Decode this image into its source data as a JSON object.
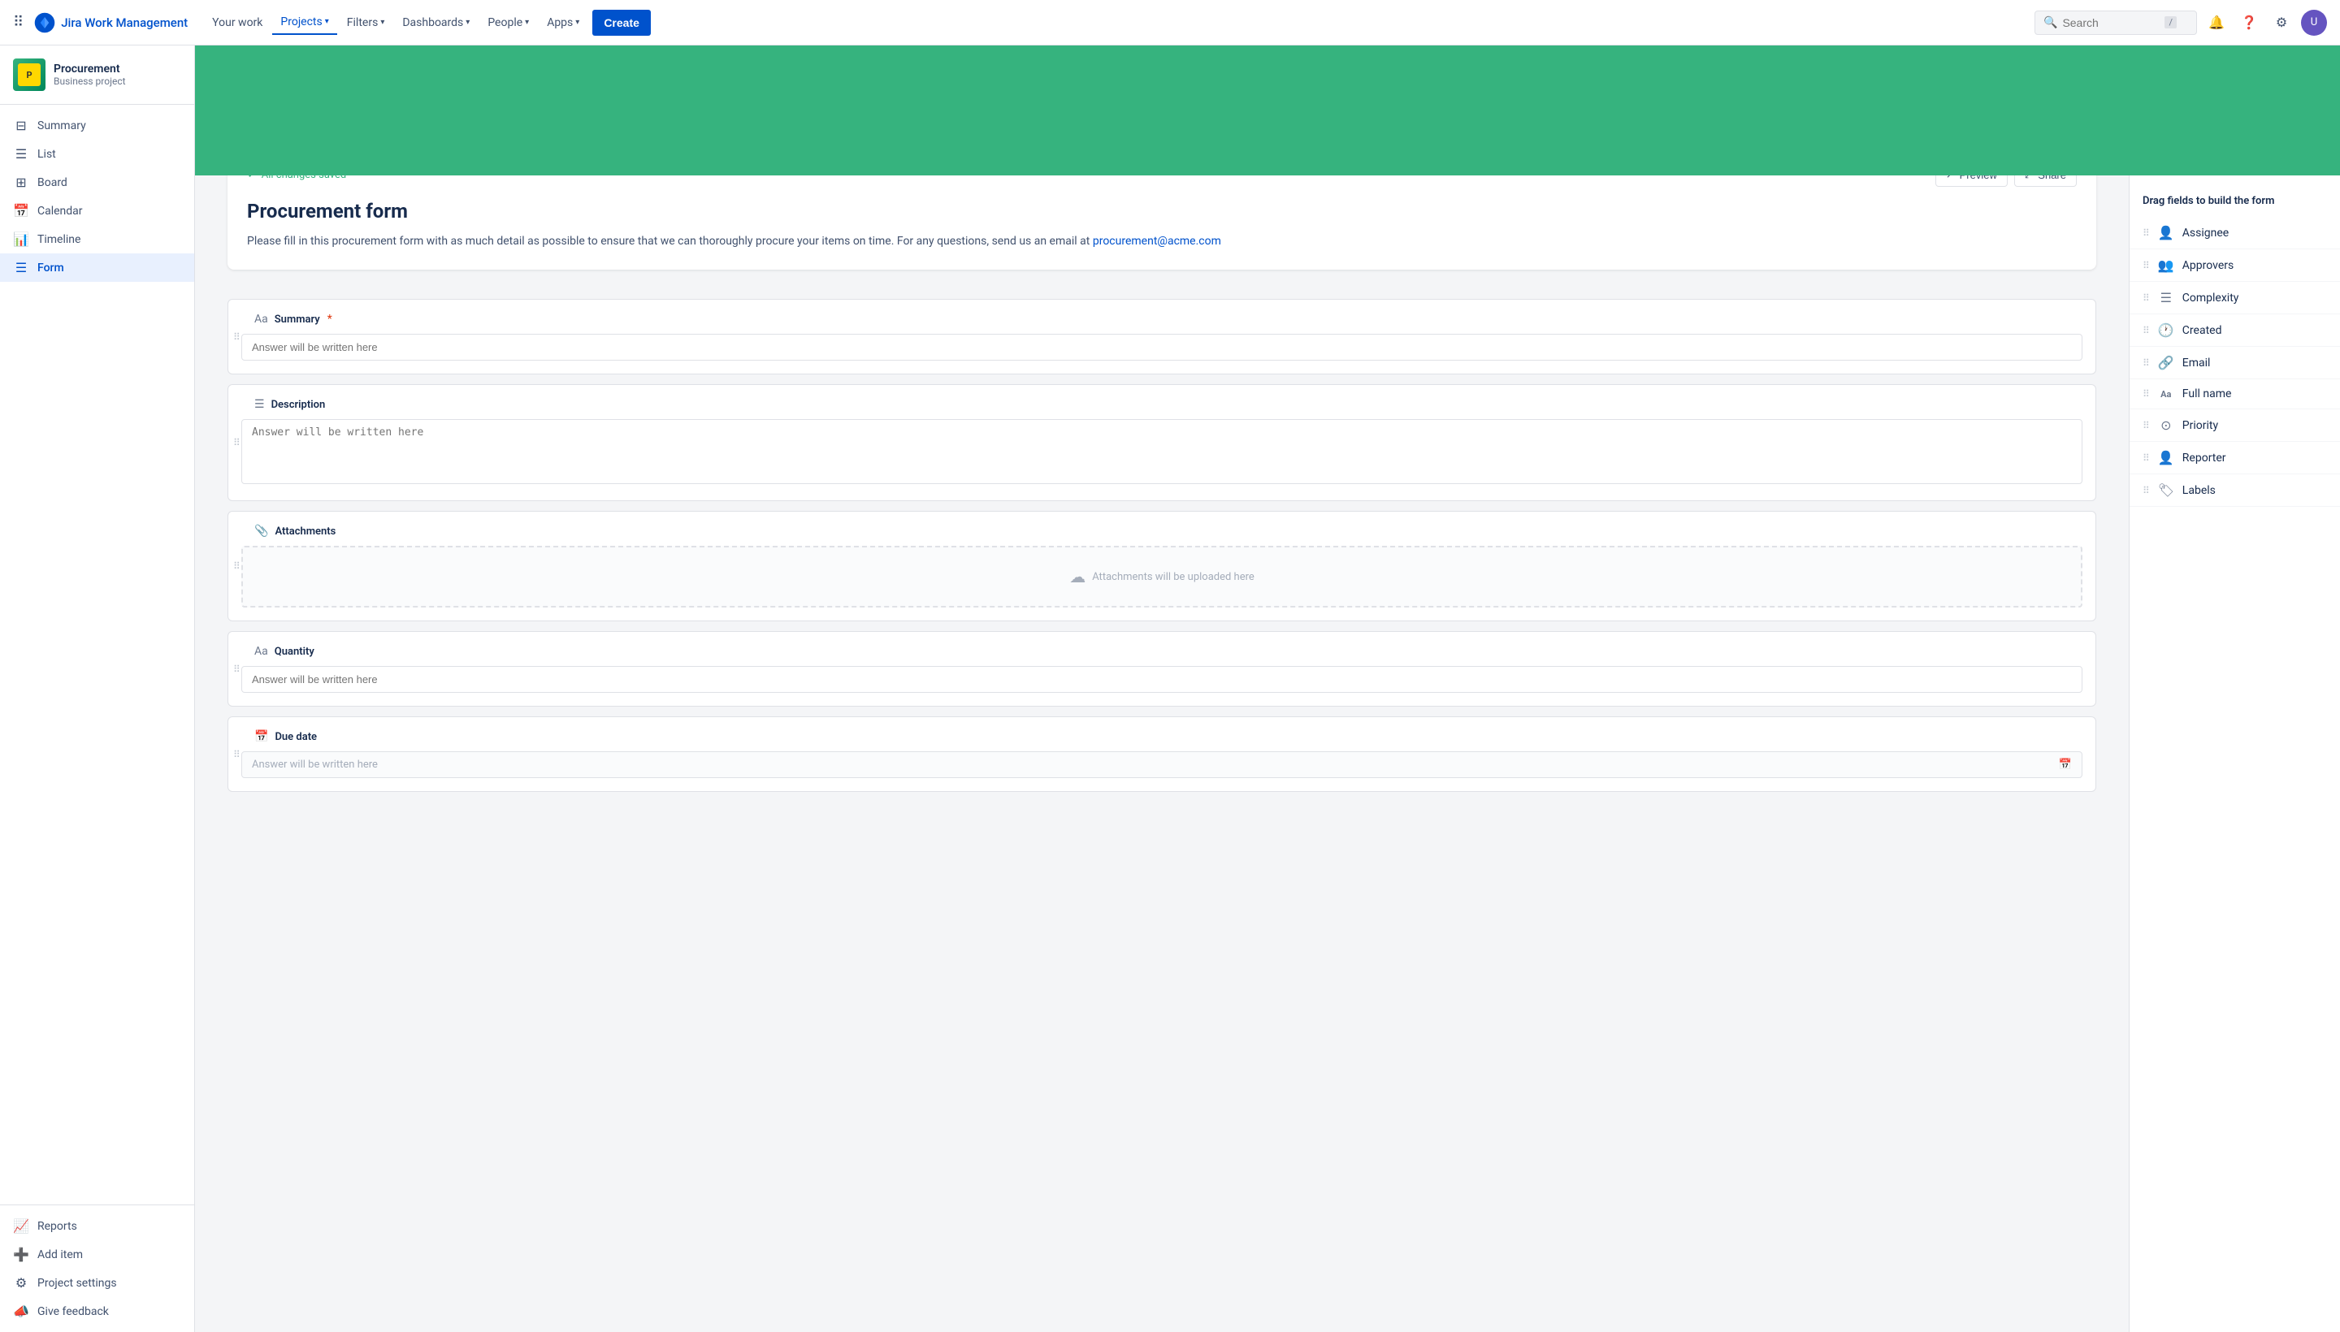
{
  "topnav": {
    "logo_text": "Jira Work Management",
    "links": [
      {
        "label": "Your work",
        "active": false
      },
      {
        "label": "Projects",
        "active": true,
        "has_chevron": true
      },
      {
        "label": "Filters",
        "active": false,
        "has_chevron": true
      },
      {
        "label": "Dashboards",
        "active": false,
        "has_chevron": true
      },
      {
        "label": "People",
        "active": false,
        "has_chevron": true
      },
      {
        "label": "Apps",
        "active": false,
        "has_chevron": true
      }
    ],
    "create_label": "Create",
    "search_placeholder": "Search",
    "search_shortcut": "/"
  },
  "sidebar": {
    "project_name": "Procurement",
    "project_type": "Business project",
    "nav_items": [
      {
        "label": "Summary",
        "icon": "⊟",
        "active": false
      },
      {
        "label": "List",
        "icon": "☰",
        "active": false
      },
      {
        "label": "Board",
        "icon": "⊞",
        "active": false
      },
      {
        "label": "Calendar",
        "icon": "📅",
        "active": false
      },
      {
        "label": "Timeline",
        "icon": "📊",
        "active": false
      },
      {
        "label": "Form",
        "icon": "☰",
        "active": true
      }
    ],
    "bottom_items": [
      {
        "label": "Reports",
        "icon": "📈",
        "active": false
      },
      {
        "label": "Add item",
        "icon": "➕",
        "active": false
      }
    ],
    "settings_items": [
      {
        "label": "Project settings",
        "icon": "⚙",
        "active": false
      },
      {
        "label": "Give feedback",
        "icon": "📣",
        "active": false
      }
    ]
  },
  "banner": {
    "color": "#36b37e"
  },
  "form": {
    "saved_text": "All changes saved",
    "preview_label": "Preview",
    "share_label": "Share",
    "title": "Procurement form",
    "description": "Please fill in this procurement form with as much detail as possible to ensure that we can thoroughly procure your items on time. For any questions, send us an email at",
    "email_link": "procurement@acme.com",
    "fields": [
      {
        "id": "summary",
        "label": "Summary",
        "required": true,
        "icon": "Aa",
        "type": "text",
        "placeholder": "Answer will be written here"
      },
      {
        "id": "description",
        "label": "Description",
        "required": false,
        "icon": "☰",
        "type": "textarea",
        "placeholder": "Answer will be written here"
      },
      {
        "id": "attachments",
        "label": "Attachments",
        "required": false,
        "icon": "📎",
        "type": "upload",
        "upload_text": "Attachments will be uploaded here"
      },
      {
        "id": "quantity",
        "label": "Quantity",
        "required": false,
        "icon": "Aa",
        "type": "text",
        "placeholder": "Answer will be written here"
      },
      {
        "id": "due_date",
        "label": "Due date",
        "required": false,
        "icon": "📅",
        "type": "date",
        "placeholder": "Answer will be written here"
      }
    ]
  },
  "right_panel": {
    "title": "Drag fields to build the form",
    "fields": [
      {
        "label": "Assignee",
        "icon": "👤"
      },
      {
        "label": "Approvers",
        "icon": "👥"
      },
      {
        "label": "Complexity",
        "icon": "☰"
      },
      {
        "label": "Created",
        "icon": "🕐"
      },
      {
        "label": "Email",
        "icon": "🔗"
      },
      {
        "label": "Full name",
        "icon": "Aa"
      },
      {
        "label": "Priority",
        "icon": "⊙"
      },
      {
        "label": "Reporter",
        "icon": "👤"
      },
      {
        "label": "Labels",
        "icon": "🏷"
      }
    ]
  }
}
